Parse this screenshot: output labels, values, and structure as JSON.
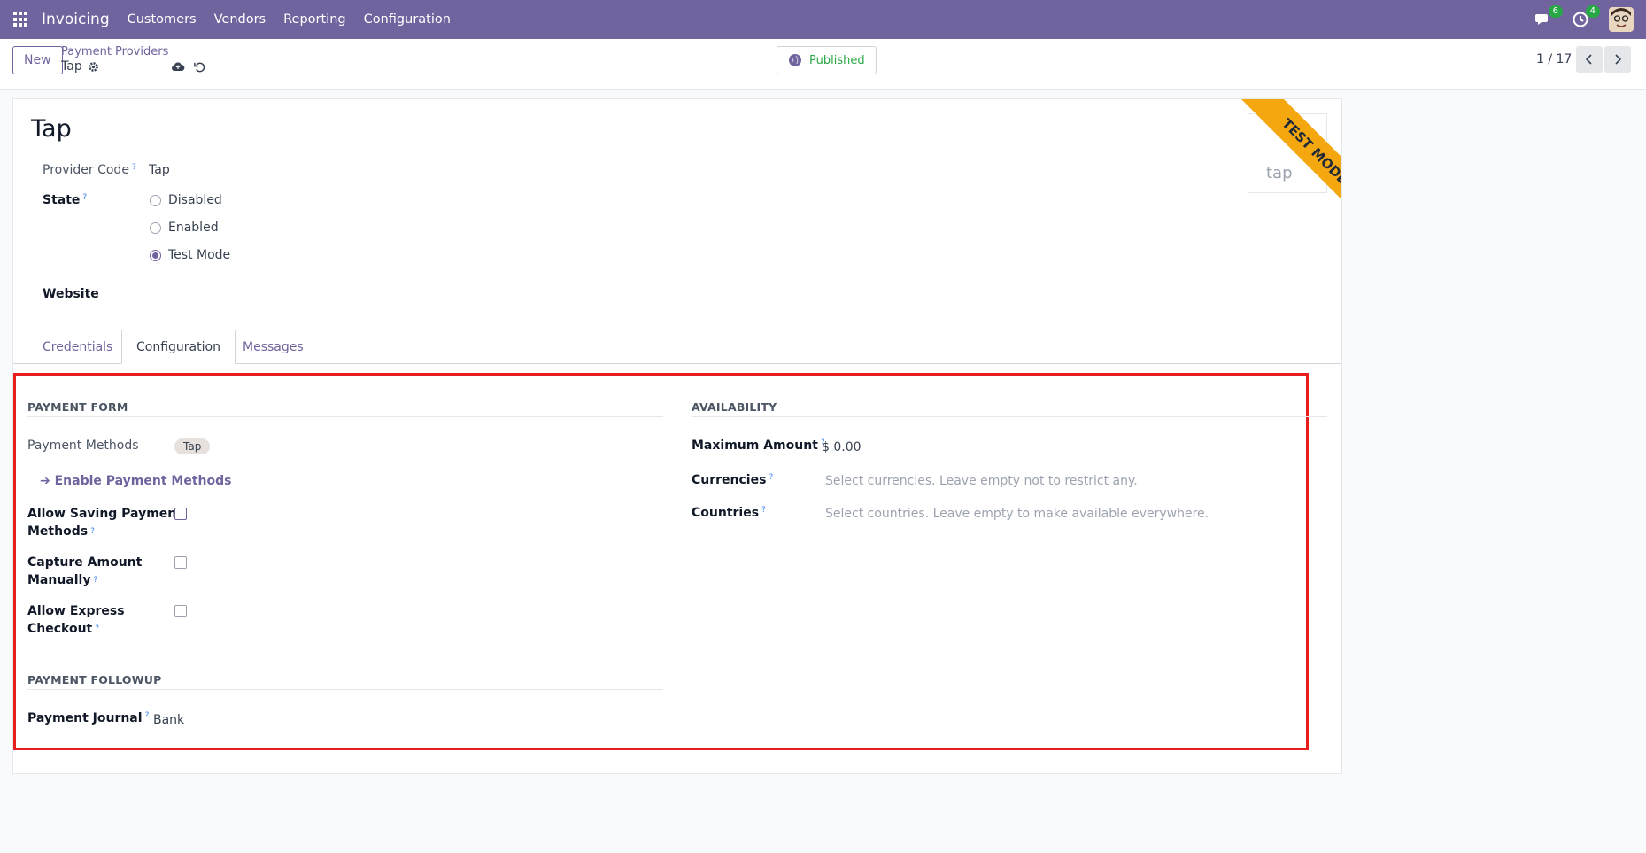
{
  "navbar": {
    "brand": "Invoicing",
    "menu": [
      "Customers",
      "Vendors",
      "Reporting",
      "Configuration"
    ],
    "messages_count": "6",
    "activities_count": "4"
  },
  "control_panel": {
    "new_label": "New",
    "breadcrumb_parent": "Payment Providers",
    "breadcrumb_current": "Tap",
    "published_label": "Published",
    "pager": "1 / 17"
  },
  "form": {
    "title": "Tap",
    "provider_code_label": "Provider Code",
    "provider_code_value": "Tap",
    "state_label": "State",
    "state_options": [
      "Disabled",
      "Enabled",
      "Test Mode"
    ],
    "state_selected": "Test Mode",
    "website_label": "Website",
    "image_text": "tap",
    "ribbon": "TEST MODE",
    "tabs": [
      "Credentials",
      "Configuration",
      "Messages"
    ],
    "active_tab": "Configuration"
  },
  "payment_form": {
    "title": "PAYMENT FORM",
    "methods_label": "Payment Methods",
    "methods_tag": "Tap",
    "enable_link": "Enable Payment Methods",
    "allow_saving_label_1": "Allow Saving Payment",
    "allow_saving_label_2": "Methods",
    "capture_label_1": "Capture Amount",
    "capture_label_2": "Manually",
    "express_label_1": "Allow Express",
    "express_label_2": "Checkout"
  },
  "availability": {
    "title": "AVAILABILITY",
    "max_amount_label": "Maximum Amount",
    "max_amount_value": "$ 0.00",
    "currencies_label": "Currencies",
    "currencies_placeholder": "Select currencies. Leave empty not to restrict any.",
    "countries_label": "Countries",
    "countries_placeholder": "Select countries. Leave empty to make available everywhere."
  },
  "followup": {
    "title": "PAYMENT FOLLOWUP",
    "journal_label": "Payment Journal",
    "journal_value": "Bank"
  },
  "colors": {
    "brand": "#71639e",
    "published": "#28a745",
    "ribbon": "#f5a70f",
    "highlight": "#e81d1d"
  }
}
